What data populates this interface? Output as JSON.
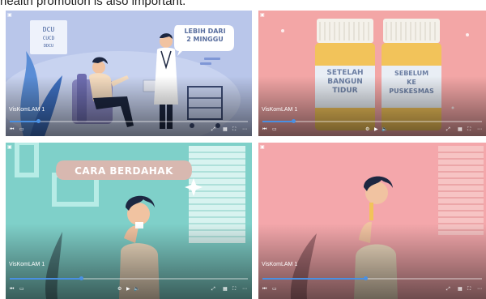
{
  "caption": "health promotion is also important.",
  "panels": [
    {
      "label": "VisKomLAM 1",
      "bubble_line1": "LEBIH DARI",
      "bubble_line2": "2 MINGGU",
      "eye_chart": "DCU CUCD DDCU",
      "progress": 0.12
    },
    {
      "label": "VisKomLAM 1",
      "bottle1_line1": "SETELAH",
      "bottle1_line2": "BANGUN",
      "bottle1_line3": "TIDUR",
      "bottle2_line1": "SEBELUM",
      "bottle2_line2": "KE",
      "bottle2_line3": "PUSKESMAS",
      "progress": 0.14
    },
    {
      "label": "VisKomLAM 1",
      "banner": "CARA BERDAHAK",
      "progress": 0.3
    },
    {
      "label": "VisKomLAM 1",
      "progress": 0.47
    }
  ],
  "controls": {
    "rewind": "⏮",
    "captions": "▭",
    "settings": "⚙",
    "play": "▶",
    "volume": "🔈",
    "expand": "⤢",
    "grid": "▦",
    "fullscreen": "⛶",
    "more": "⋯"
  },
  "colors": {
    "progress": "#4a90e2",
    "panel1_bg": "#b9c6ea",
    "panel2_bg": "#f3a6a6",
    "panel3_bg": "#7fd0c9",
    "panel4_bg": "#f4a7ab",
    "bottle_cap": "#f4f1ea",
    "bottle_body": "#f2c35a",
    "bottle_label": "#e9eef5",
    "bottle_text": "#6c7fa3",
    "banner_bg": "#d8b8b0",
    "banner_text": "#ffffff"
  }
}
